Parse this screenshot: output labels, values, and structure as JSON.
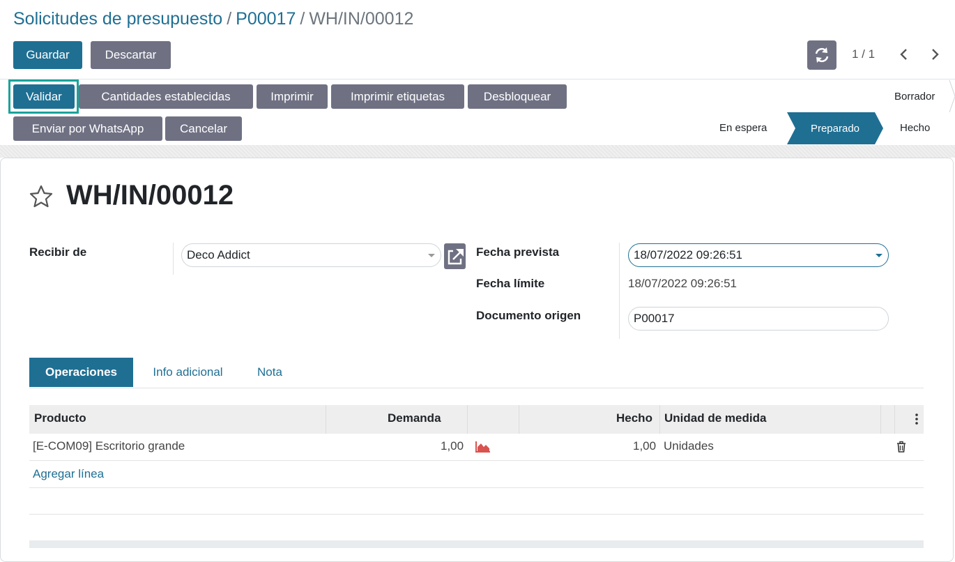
{
  "breadcrumb": {
    "item1": "Solicitudes de presupuesto",
    "sep": "/",
    "item2": "P00017",
    "current": "WH/IN/00012"
  },
  "control_panel": {
    "save_label": "Guardar",
    "discard_label": "Descartar",
    "pager": "1 / 1",
    "refresh_icon": "refresh-icon",
    "prev_icon": "chevron-left-icon",
    "next_icon": "chevron-right-icon"
  },
  "actions": {
    "validate": "Validar",
    "set_quantities": "Cantidades establecidas",
    "print": "Imprimir",
    "print_labels": "Imprimir etiquetas",
    "unlock": "Desbloquear",
    "whatsapp": "Enviar por WhatsApp",
    "cancel": "Cancelar"
  },
  "status": {
    "draft": "Borrador",
    "waiting": "En espera",
    "ready": "Preparado",
    "done": "Hecho"
  },
  "record": {
    "name": "WH/IN/00012",
    "receive_from_label": "Recibir de",
    "receive_from_value": "Deco Addict",
    "scheduled_label": "Fecha prevista",
    "scheduled_value": "18/07/2022 09:26:51",
    "deadline_label": "Fecha límite",
    "deadline_value": "18/07/2022 09:26:51",
    "origin_label": "Documento origen",
    "origin_value": "P00017"
  },
  "tabs": {
    "operations": "Operaciones",
    "extra_info": "Info adicional",
    "note": "Nota"
  },
  "table": {
    "headers": {
      "product": "Producto",
      "demand": "Demanda",
      "done": "Hecho",
      "uom": "Unidad de medida"
    },
    "rows": [
      {
        "product": "[E-COM09] Escritorio grande",
        "demand": "1,00",
        "done": "1,00",
        "uom": "Unidades"
      }
    ],
    "add_line": "Agregar línea"
  },
  "colors": {
    "primary": "#1f6f93",
    "secondary": "#6f7183",
    "focus": "#1aa39a",
    "forecast": "#d9534f"
  }
}
